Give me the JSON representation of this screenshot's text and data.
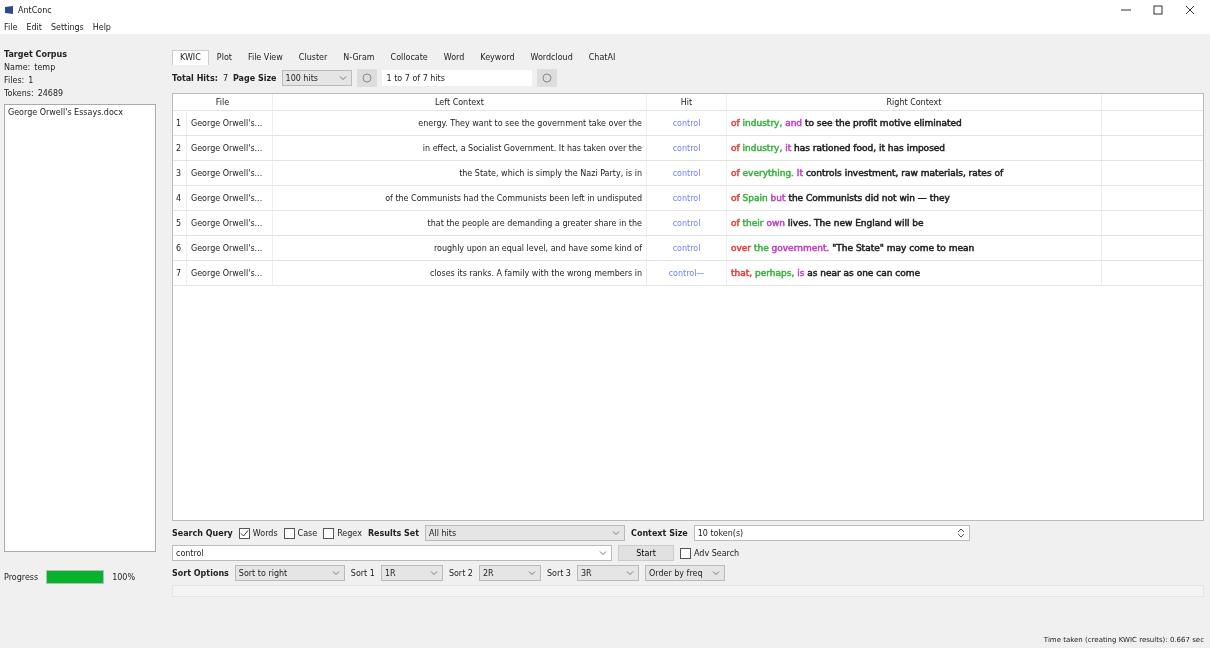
{
  "window": {
    "title": "AntConc"
  },
  "menu": [
    "File",
    "Edit",
    "Settings",
    "Help"
  ],
  "corpus": {
    "heading": "Target Corpus",
    "name_label": "Name:",
    "name": "temp",
    "files_label": "Files:",
    "files": "1",
    "tokens_label": "Tokens:",
    "tokens": "24689",
    "files_list": [
      "George Orwell's Essays.docx"
    ]
  },
  "progress": {
    "label": "Progress",
    "level": 1,
    "reading": "100%"
  },
  "tabs": [
    {
      "label": "KWIC",
      "selected": true
    },
    {
      "label": "Plot",
      "selected": false
    },
    {
      "label": "File View",
      "selected": false
    },
    {
      "label": "Cluster",
      "selected": false
    },
    {
      "label": "N-Gram",
      "selected": false
    },
    {
      "label": "Collocate",
      "selected": false
    },
    {
      "label": "Word",
      "selected": false
    },
    {
      "label": "Keyword",
      "selected": false
    },
    {
      "label": "Wordcloud",
      "selected": false
    },
    {
      "label": "ChatAI",
      "selected": false
    }
  ],
  "hits_bar": {
    "total_label": "Total Hits:",
    "total": "7",
    "page_size_label": "Page Size",
    "page_size": "100 hits",
    "range": "1 to 7 of 7 hits"
  },
  "table": {
    "columns": [
      "File",
      "Left Context",
      "Hit",
      "Right Context"
    ],
    "rows": [
      {
        "num": "1",
        "file": "George Orwell's...",
        "left": "energy. They want to see the government take over the",
        "hit": "control",
        "right": [
          {
            "text": "of",
            "color": "#e0403a"
          },
          {
            "text": "industry,",
            "color": "#3cb043"
          },
          {
            "text": "and",
            "color": "#c040c0"
          },
          {
            "text": "to see the profit motive eliminated",
            "color": "#202020"
          }
        ]
      },
      {
        "num": "2",
        "file": "George Orwell's...",
        "left": "in effect, a Socialist Government. It has taken over the",
        "hit": "control",
        "right": [
          {
            "text": "of",
            "color": "#e0403a"
          },
          {
            "text": "industry,",
            "color": "#3cb043"
          },
          {
            "text": "it",
            "color": "#c040c0"
          },
          {
            "text": "has rationed food, it has imposed",
            "color": "#202020"
          }
        ]
      },
      {
        "num": "3",
        "file": "George Orwell's...",
        "left": "the State, which is simply the Nazi Party, is in",
        "hit": "control",
        "right": [
          {
            "text": "of",
            "color": "#e0403a"
          },
          {
            "text": "everything.",
            "color": "#3cb043"
          },
          {
            "text": "It",
            "color": "#c040c0"
          },
          {
            "text": "controls investment, raw materials, rates of",
            "color": "#202020"
          }
        ]
      },
      {
        "num": "4",
        "file": "George Orwell's...",
        "left": "of the Communists had the Communists been left in undisputed",
        "hit": "control",
        "right": [
          {
            "text": "of",
            "color": "#e0403a"
          },
          {
            "text": "Spain",
            "color": "#3cb043"
          },
          {
            "text": "but",
            "color": "#c040c0"
          },
          {
            "text": "the Communists did not win — they",
            "color": "#202020"
          }
        ]
      },
      {
        "num": "5",
        "file": "George Orwell's...",
        "left": "that the people are demanding a greater share in the",
        "hit": "control",
        "right": [
          {
            "text": "of",
            "color": "#e0403a"
          },
          {
            "text": "their",
            "color": "#3cb043"
          },
          {
            "text": "own",
            "color": "#c040c0"
          },
          {
            "text": "lives. The new England will be",
            "color": "#202020"
          }
        ]
      },
      {
        "num": "6",
        "file": "George Orwell's...",
        "left": "roughly upon an equal level, and have some kind of",
        "hit": "control",
        "right": [
          {
            "text": "over",
            "color": "#e0403a"
          },
          {
            "text": "the",
            "color": "#3cb043"
          },
          {
            "text": "government.",
            "color": "#c040c0"
          },
          {
            "text": "\"The State\" may come to mean",
            "color": "#202020"
          }
        ]
      },
      {
        "num": "7",
        "file": "George Orwell's...",
        "left": "closes its ranks. A family with the wrong members in",
        "hit": "control—",
        "right": [
          {
            "text": "that,",
            "color": "#e0403a"
          },
          {
            "text": "perhaps,",
            "color": "#3cb043"
          },
          {
            "text": "is",
            "color": "#c040c0"
          },
          {
            "text": "as near as one can come",
            "color": "#202020"
          }
        ]
      }
    ]
  },
  "search": {
    "label": "Search Query",
    "options": [
      {
        "label": "Words",
        "checked": true
      },
      {
        "label": "Case",
        "checked": false
      },
      {
        "label": "Regex",
        "checked": false
      }
    ],
    "results_set_label": "Results Set",
    "results_set": "All hits",
    "context_size_label": "Context Size",
    "context_size": "10 token(s)",
    "query": "control",
    "start": "Start",
    "adv": {
      "label": "Adv Search",
      "checked": false
    }
  },
  "sort": {
    "label": "Sort Options",
    "mode": "Sort to right",
    "sorts": [
      {
        "label": "Sort 1",
        "value": "1R"
      },
      {
        "label": "Sort 2",
        "value": "2R"
      },
      {
        "label": "Sort 3",
        "value": "3R"
      }
    ],
    "order": "Order by freq"
  },
  "status_bar": "Time taken (creating KWIC results): 0.667 sec"
}
